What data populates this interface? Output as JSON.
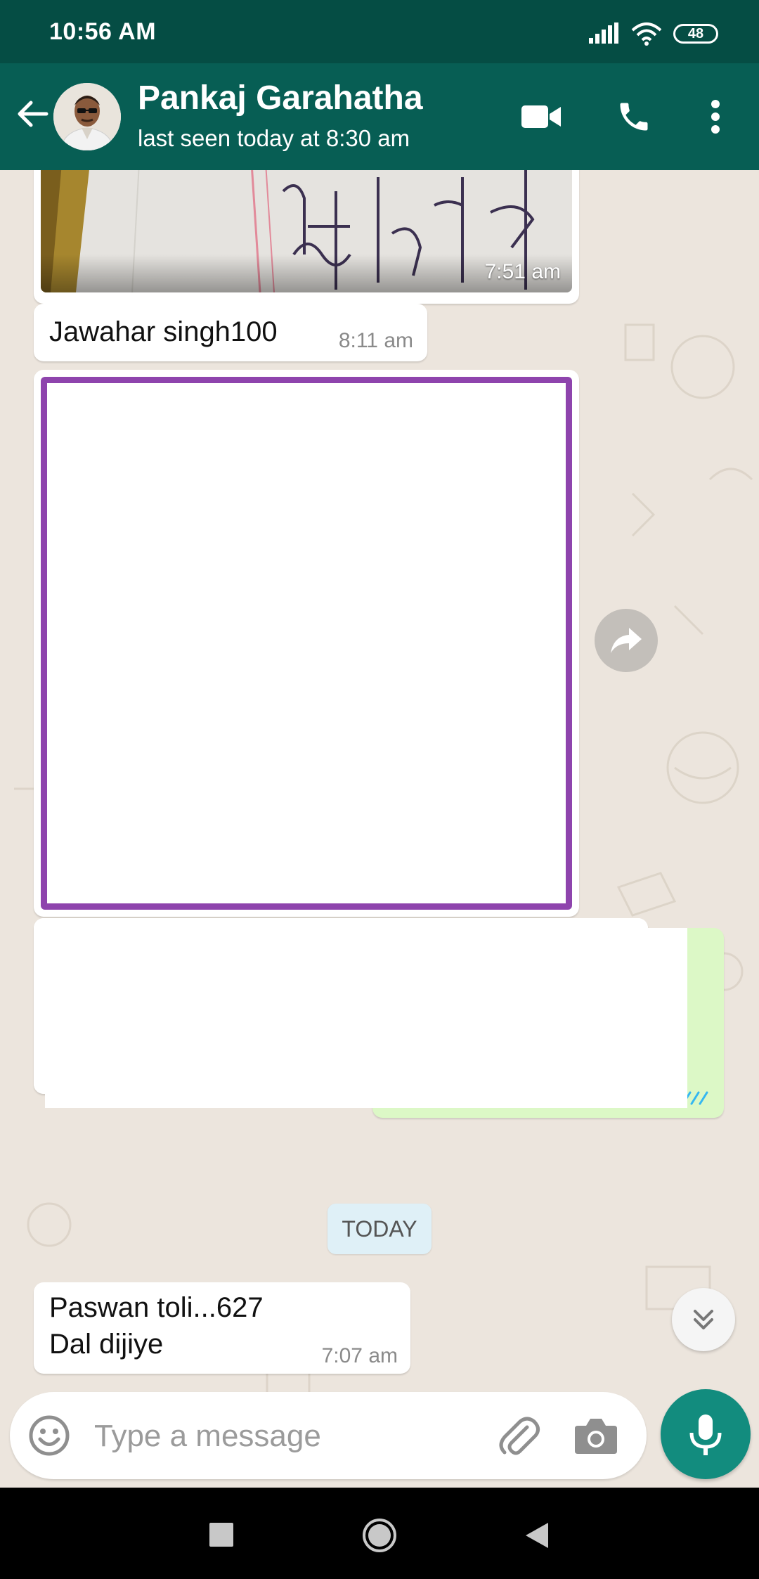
{
  "status_bar": {
    "time": "10:56 AM",
    "battery": "48",
    "icons": [
      "signal-icon",
      "wifi-icon",
      "battery-icon"
    ]
  },
  "header": {
    "contact_name": "Pankaj Garahatha",
    "last_seen": "last seen today at 8:30 am",
    "icons": [
      "back-arrow-icon",
      "video-call-icon",
      "voice-call-icon",
      "more-options-icon"
    ]
  },
  "messages": [
    {
      "type": "image",
      "time": "7:51 am",
      "direction": "incoming"
    },
    {
      "type": "text",
      "text": "Jawahar singh100",
      "time": "8:11 am",
      "direction": "incoming"
    },
    {
      "type": "image",
      "direction": "incoming"
    },
    {
      "type": "image",
      "direction": "incoming"
    },
    {
      "type": "image",
      "direction": "outgoing",
      "status": "read"
    }
  ],
  "date_divider": "TODAY",
  "last_message": {
    "line1": "Paswan toli...627",
    "line2": "Dal dijiye",
    "time": "7:07 am"
  },
  "composer": {
    "placeholder": "Type a message",
    "icons": [
      "emoji-icon",
      "attach-icon",
      "camera-icon",
      "mic-icon"
    ]
  },
  "colors": {
    "header": "#075e54",
    "status_bar": "#054d44",
    "accent": "#128c7e",
    "chat_bg": "#ece5dd",
    "outgoing_bubble": "#dcf8c6",
    "image_frame": "#8e44ad",
    "read_tick": "#34b7f1"
  }
}
